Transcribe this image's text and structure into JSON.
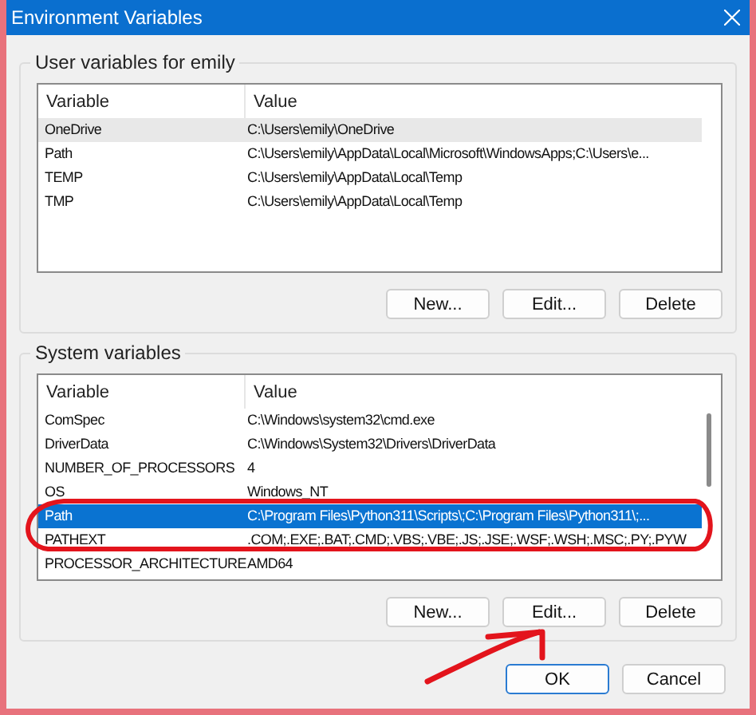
{
  "window": {
    "title": "Environment Variables"
  },
  "user_variables": {
    "label": "User variables for emily",
    "focused": false,
    "scrollbar": false,
    "columns": [
      "Variable",
      "Value"
    ],
    "rows": [
      {
        "variable": "OneDrive",
        "value": "C:\\Users\\emily\\OneDrive",
        "selected": true
      },
      {
        "variable": "Path",
        "value": "C:\\Users\\emily\\AppData\\Local\\Microsoft\\WindowsApps;C:\\Users\\e...",
        "selected": false
      },
      {
        "variable": "TEMP",
        "value": "C:\\Users\\emily\\AppData\\Local\\Temp",
        "selected": false
      },
      {
        "variable": "TMP",
        "value": "C:\\Users\\emily\\AppData\\Local\\Temp",
        "selected": false
      }
    ],
    "buttons": [
      "New...",
      "Edit...",
      "Delete"
    ]
  },
  "system_variables": {
    "label": "System variables",
    "focused": true,
    "scrollbar": true,
    "columns": [
      "Variable",
      "Value"
    ],
    "rows": [
      {
        "variable": "ComSpec",
        "value": "C:\\Windows\\system32\\cmd.exe",
        "selected": false
      },
      {
        "variable": "DriverData",
        "value": "C:\\Windows\\System32\\Drivers\\DriverData",
        "selected": false
      },
      {
        "variable": "NUMBER_OF_PROCESSORS",
        "value": "4",
        "selected": false
      },
      {
        "variable": "OS",
        "value": "Windows_NT",
        "selected": false
      },
      {
        "variable": "Path",
        "value": "C:\\Program Files\\Python311\\Scripts\\;C:\\Program Files\\Python311\\;...",
        "selected": true
      },
      {
        "variable": "PATHEXT",
        "value": ".COM;.EXE;.BAT;.CMD;.VBS;.VBE;.JS;.JSE;.WSF;.WSH;.MSC;.PY;.PYW",
        "selected": false
      },
      {
        "variable": "PROCESSOR_ARCHITECTURE",
        "value": "AMD64",
        "selected": false
      }
    ],
    "buttons": [
      "New...",
      "Edit...",
      "Delete"
    ]
  },
  "buttons": [
    {
      "label": "OK",
      "default": true
    },
    {
      "label": "Cancel",
      "default": false
    }
  ]
}
